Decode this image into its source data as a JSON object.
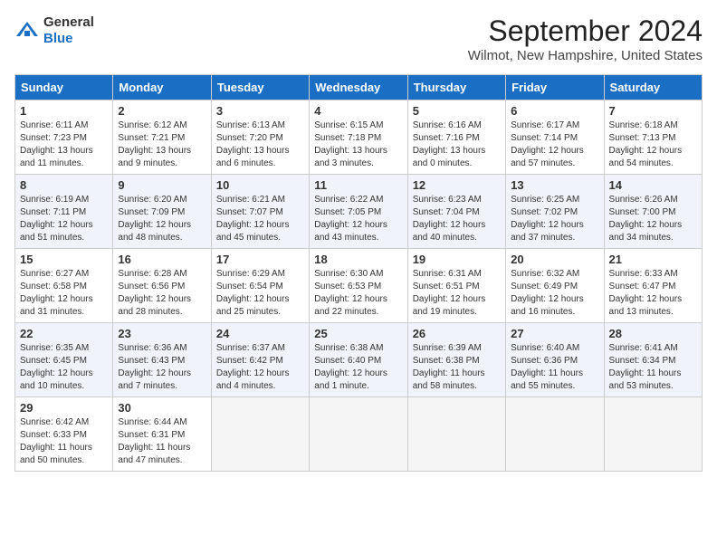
{
  "header": {
    "logo_general": "General",
    "logo_blue": "Blue",
    "month_title": "September 2024",
    "subtitle": "Wilmot, New Hampshire, United States"
  },
  "days_of_week": [
    "Sunday",
    "Monday",
    "Tuesday",
    "Wednesday",
    "Thursday",
    "Friday",
    "Saturday"
  ],
  "weeks": [
    [
      {
        "day": 1,
        "lines": [
          "Sunrise: 6:11 AM",
          "Sunset: 7:23 PM",
          "Daylight: 13 hours",
          "and 11 minutes."
        ]
      },
      {
        "day": 2,
        "lines": [
          "Sunrise: 6:12 AM",
          "Sunset: 7:21 PM",
          "Daylight: 13 hours",
          "and 9 minutes."
        ]
      },
      {
        "day": 3,
        "lines": [
          "Sunrise: 6:13 AM",
          "Sunset: 7:20 PM",
          "Daylight: 13 hours",
          "and 6 minutes."
        ]
      },
      {
        "day": 4,
        "lines": [
          "Sunrise: 6:15 AM",
          "Sunset: 7:18 PM",
          "Daylight: 13 hours",
          "and 3 minutes."
        ]
      },
      {
        "day": 5,
        "lines": [
          "Sunrise: 6:16 AM",
          "Sunset: 7:16 PM",
          "Daylight: 13 hours",
          "and 0 minutes."
        ]
      },
      {
        "day": 6,
        "lines": [
          "Sunrise: 6:17 AM",
          "Sunset: 7:14 PM",
          "Daylight: 12 hours",
          "and 57 minutes."
        ]
      },
      {
        "day": 7,
        "lines": [
          "Sunrise: 6:18 AM",
          "Sunset: 7:13 PM",
          "Daylight: 12 hours",
          "and 54 minutes."
        ]
      }
    ],
    [
      {
        "day": 8,
        "lines": [
          "Sunrise: 6:19 AM",
          "Sunset: 7:11 PM",
          "Daylight: 12 hours",
          "and 51 minutes."
        ]
      },
      {
        "day": 9,
        "lines": [
          "Sunrise: 6:20 AM",
          "Sunset: 7:09 PM",
          "Daylight: 12 hours",
          "and 48 minutes."
        ]
      },
      {
        "day": 10,
        "lines": [
          "Sunrise: 6:21 AM",
          "Sunset: 7:07 PM",
          "Daylight: 12 hours",
          "and 45 minutes."
        ]
      },
      {
        "day": 11,
        "lines": [
          "Sunrise: 6:22 AM",
          "Sunset: 7:05 PM",
          "Daylight: 12 hours",
          "and 43 minutes."
        ]
      },
      {
        "day": 12,
        "lines": [
          "Sunrise: 6:23 AM",
          "Sunset: 7:04 PM",
          "Daylight: 12 hours",
          "and 40 minutes."
        ]
      },
      {
        "day": 13,
        "lines": [
          "Sunrise: 6:25 AM",
          "Sunset: 7:02 PM",
          "Daylight: 12 hours",
          "and 37 minutes."
        ]
      },
      {
        "day": 14,
        "lines": [
          "Sunrise: 6:26 AM",
          "Sunset: 7:00 PM",
          "Daylight: 12 hours",
          "and 34 minutes."
        ]
      }
    ],
    [
      {
        "day": 15,
        "lines": [
          "Sunrise: 6:27 AM",
          "Sunset: 6:58 PM",
          "Daylight: 12 hours",
          "and 31 minutes."
        ]
      },
      {
        "day": 16,
        "lines": [
          "Sunrise: 6:28 AM",
          "Sunset: 6:56 PM",
          "Daylight: 12 hours",
          "and 28 minutes."
        ]
      },
      {
        "day": 17,
        "lines": [
          "Sunrise: 6:29 AM",
          "Sunset: 6:54 PM",
          "Daylight: 12 hours",
          "and 25 minutes."
        ]
      },
      {
        "day": 18,
        "lines": [
          "Sunrise: 6:30 AM",
          "Sunset: 6:53 PM",
          "Daylight: 12 hours",
          "and 22 minutes."
        ]
      },
      {
        "day": 19,
        "lines": [
          "Sunrise: 6:31 AM",
          "Sunset: 6:51 PM",
          "Daylight: 12 hours",
          "and 19 minutes."
        ]
      },
      {
        "day": 20,
        "lines": [
          "Sunrise: 6:32 AM",
          "Sunset: 6:49 PM",
          "Daylight: 12 hours",
          "and 16 minutes."
        ]
      },
      {
        "day": 21,
        "lines": [
          "Sunrise: 6:33 AM",
          "Sunset: 6:47 PM",
          "Daylight: 12 hours",
          "and 13 minutes."
        ]
      }
    ],
    [
      {
        "day": 22,
        "lines": [
          "Sunrise: 6:35 AM",
          "Sunset: 6:45 PM",
          "Daylight: 12 hours",
          "and 10 minutes."
        ]
      },
      {
        "day": 23,
        "lines": [
          "Sunrise: 6:36 AM",
          "Sunset: 6:43 PM",
          "Daylight: 12 hours",
          "and 7 minutes."
        ]
      },
      {
        "day": 24,
        "lines": [
          "Sunrise: 6:37 AM",
          "Sunset: 6:42 PM",
          "Daylight: 12 hours",
          "and 4 minutes."
        ]
      },
      {
        "day": 25,
        "lines": [
          "Sunrise: 6:38 AM",
          "Sunset: 6:40 PM",
          "Daylight: 12 hours",
          "and 1 minute."
        ]
      },
      {
        "day": 26,
        "lines": [
          "Sunrise: 6:39 AM",
          "Sunset: 6:38 PM",
          "Daylight: 11 hours",
          "and 58 minutes."
        ]
      },
      {
        "day": 27,
        "lines": [
          "Sunrise: 6:40 AM",
          "Sunset: 6:36 PM",
          "Daylight: 11 hours",
          "and 55 minutes."
        ]
      },
      {
        "day": 28,
        "lines": [
          "Sunrise: 6:41 AM",
          "Sunset: 6:34 PM",
          "Daylight: 11 hours",
          "and 53 minutes."
        ]
      }
    ],
    [
      {
        "day": 29,
        "lines": [
          "Sunrise: 6:42 AM",
          "Sunset: 6:33 PM",
          "Daylight: 11 hours",
          "and 50 minutes."
        ]
      },
      {
        "day": 30,
        "lines": [
          "Sunrise: 6:44 AM",
          "Sunset: 6:31 PM",
          "Daylight: 11 hours",
          "and 47 minutes."
        ]
      },
      null,
      null,
      null,
      null,
      null
    ]
  ]
}
